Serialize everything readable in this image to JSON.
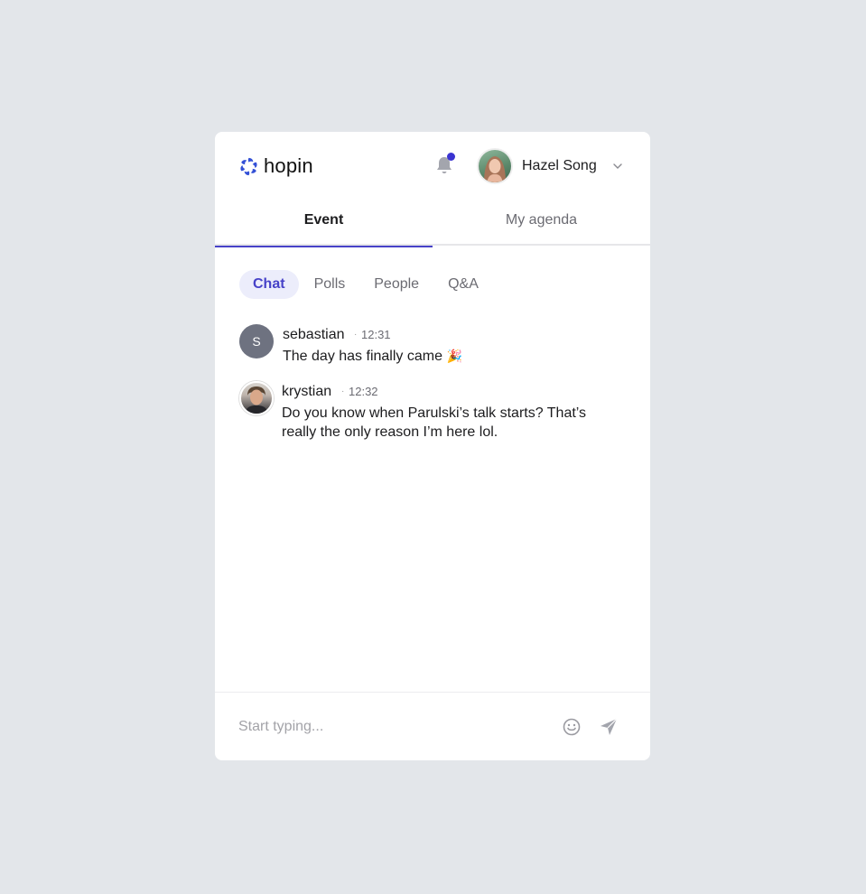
{
  "header": {
    "logo_text": "hopin",
    "user_name": "Hazel Song",
    "has_notification": true
  },
  "tabs": [
    {
      "label": "Event",
      "active": true
    },
    {
      "label": "My agenda",
      "active": false
    }
  ],
  "subtabs": [
    {
      "label": "Chat",
      "active": true
    },
    {
      "label": "Polls",
      "active": false
    },
    {
      "label": "People",
      "active": false
    },
    {
      "label": "Q&A",
      "active": false
    }
  ],
  "messages": [
    {
      "author": "sebastian",
      "initial": "S",
      "separator": "·",
      "time": "12:31",
      "text": "The day has finally came",
      "emoji": "🎉"
    },
    {
      "author": "krystian",
      "separator": "·",
      "time": "12:32",
      "text": "Do you know when Parulski’s talk starts? That’s really the only reason I’m here lol."
    }
  ],
  "composer": {
    "placeholder": "Start typing..."
  },
  "colors": {
    "accent": "#4742c8",
    "notification_dot": "#3a33d1",
    "background": "#e3e6ea"
  },
  "icons": [
    "hopin-logo-icon",
    "bell-icon",
    "chevron-down-icon",
    "emoji-icon",
    "send-icon"
  ]
}
